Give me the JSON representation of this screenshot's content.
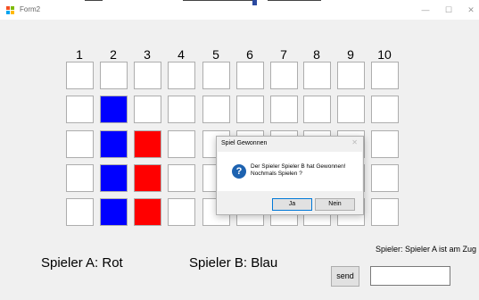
{
  "window": {
    "title": "Form2",
    "minimize_glyph": "—",
    "maximize_glyph": "☐",
    "close_glyph": "✕"
  },
  "board": {
    "column_numbers": [
      "1",
      "2",
      "3",
      "4",
      "5",
      "6",
      "7",
      "8",
      "9",
      "10"
    ],
    "rows": 5,
    "colors": {
      "red": "#ff0000",
      "blue": "#0000ff",
      "empty": "#ffffff"
    },
    "filled": [
      {
        "row": 2,
        "col": 2,
        "color": "blue"
      },
      {
        "row": 3,
        "col": 2,
        "color": "blue"
      },
      {
        "row": 4,
        "col": 2,
        "color": "blue"
      },
      {
        "row": 5,
        "col": 2,
        "color": "blue"
      },
      {
        "row": 3,
        "col": 3,
        "color": "red"
      },
      {
        "row": 4,
        "col": 3,
        "color": "red"
      },
      {
        "row": 5,
        "col": 3,
        "color": "red"
      }
    ]
  },
  "labels": {
    "player_a": "Spieler A: Rot",
    "player_b": "Spieler B: Blau",
    "status": "Spieler: Spieler A ist am Zug"
  },
  "controls": {
    "send_label": "send",
    "input_value": ""
  },
  "dialog": {
    "title": "Spiel Gewonnen",
    "close_glyph": "✕",
    "icon": "question-icon",
    "message_line1": "Der Spieler Spieler B hat Gewonnen!",
    "message_line2": "Nochmals Spielen ?",
    "yes_label": "Ja",
    "no_label": "Nein"
  }
}
